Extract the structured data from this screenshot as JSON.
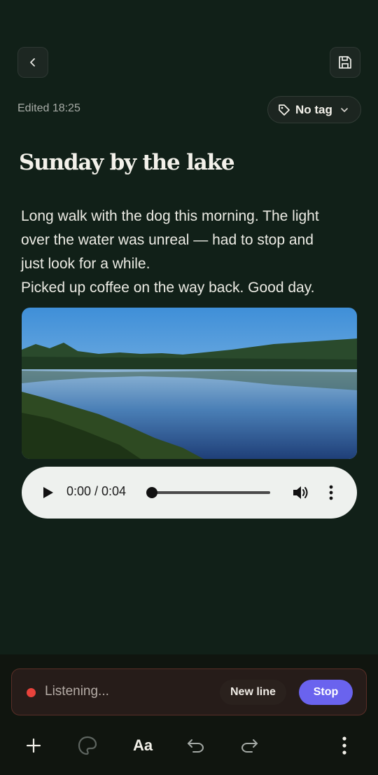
{
  "header": {
    "edited": "Edited 18:25",
    "tag_label": "No tag"
  },
  "note": {
    "title": "Sunday by the lake",
    "body_lines": [
      "Long walk with the dog this morning. The light",
      "over the water was unreal — had to stop and",
      "just look for a while.",
      "Picked up coffee on the way back. Good day."
    ]
  },
  "audio": {
    "time": "0:00 / 0:04",
    "progress": 0.0
  },
  "dictation": {
    "status": "Listening...",
    "newline_label": "New line",
    "stop_label": "Stop"
  },
  "toolbar": {
    "format_label": "Aa"
  },
  "icons": {
    "back": "chevron-left-icon",
    "save": "floppy-disk-icon",
    "tag": "tag-icon",
    "chevron": "chevron-down-icon",
    "add": "plus-icon",
    "palette": "palette-icon",
    "undo": "undo-icon",
    "redo": "redo-icon",
    "more": "more-vertical-icon"
  },
  "colors": {
    "background": "#112018",
    "accent": "#6a63ee",
    "recording": "#e8423b"
  }
}
